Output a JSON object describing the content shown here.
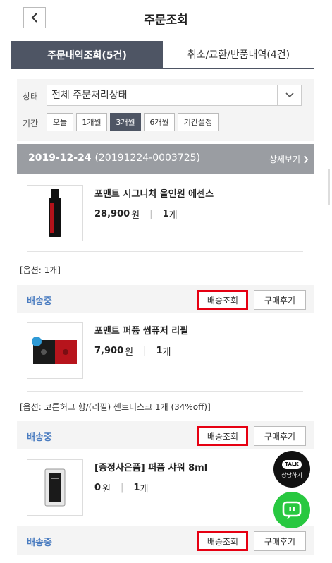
{
  "header": {
    "title": "주문조회",
    "back_icon": "chevron-left-icon"
  },
  "tabs": [
    {
      "label": "주문내역조회(5건)",
      "active": true
    },
    {
      "label": "취소/교환/반품내역(4건)",
      "active": false
    }
  ],
  "filter": {
    "status_label": "상태",
    "status_value": "전체 주문처리상태",
    "period_label": "기간",
    "periods": [
      "오늘",
      "1개월",
      "3개월",
      "6개월",
      "기간설정"
    ],
    "active_period": "3개월"
  },
  "order": {
    "date": "2019-12-24",
    "number": "(20191224-0003725)",
    "detail_label": "상세보기"
  },
  "items": [
    {
      "name": "포맨트 시그니처 올인원 에센스",
      "price": "28,900",
      "won": "원",
      "qty": "1",
      "qty_unit": "개",
      "option": "[옵션: 1개]",
      "status": "배송중",
      "track_label": "배송조회",
      "review_label": "구매후기"
    },
    {
      "name": "포맨트 퍼퓸 썸퓨저 리필",
      "price": "7,900",
      "won": "원",
      "qty": "1",
      "qty_unit": "개",
      "option": "[옵션: 코튼허그 향/(리필) 센트디스크 1개 (34%off)]",
      "status": "배송중",
      "track_label": "배송조회",
      "review_label": "구매후기"
    },
    {
      "name": "[증정사은품] 퍼퓸 샤워 8ml",
      "price": "0",
      "won": "원",
      "qty": "1",
      "qty_unit": "개",
      "status": "배송중",
      "track_label": "배송조회",
      "review_label": "구매후기"
    }
  ],
  "floating": {
    "talk_badge": "TALK",
    "talk_label": "상담하기"
  },
  "colors": {
    "tab_active": "#4e5564",
    "order_head": "#9a9da2",
    "ship_status": "#4a7cc0",
    "highlight": "#e60012",
    "chat_green": "#28c840"
  }
}
